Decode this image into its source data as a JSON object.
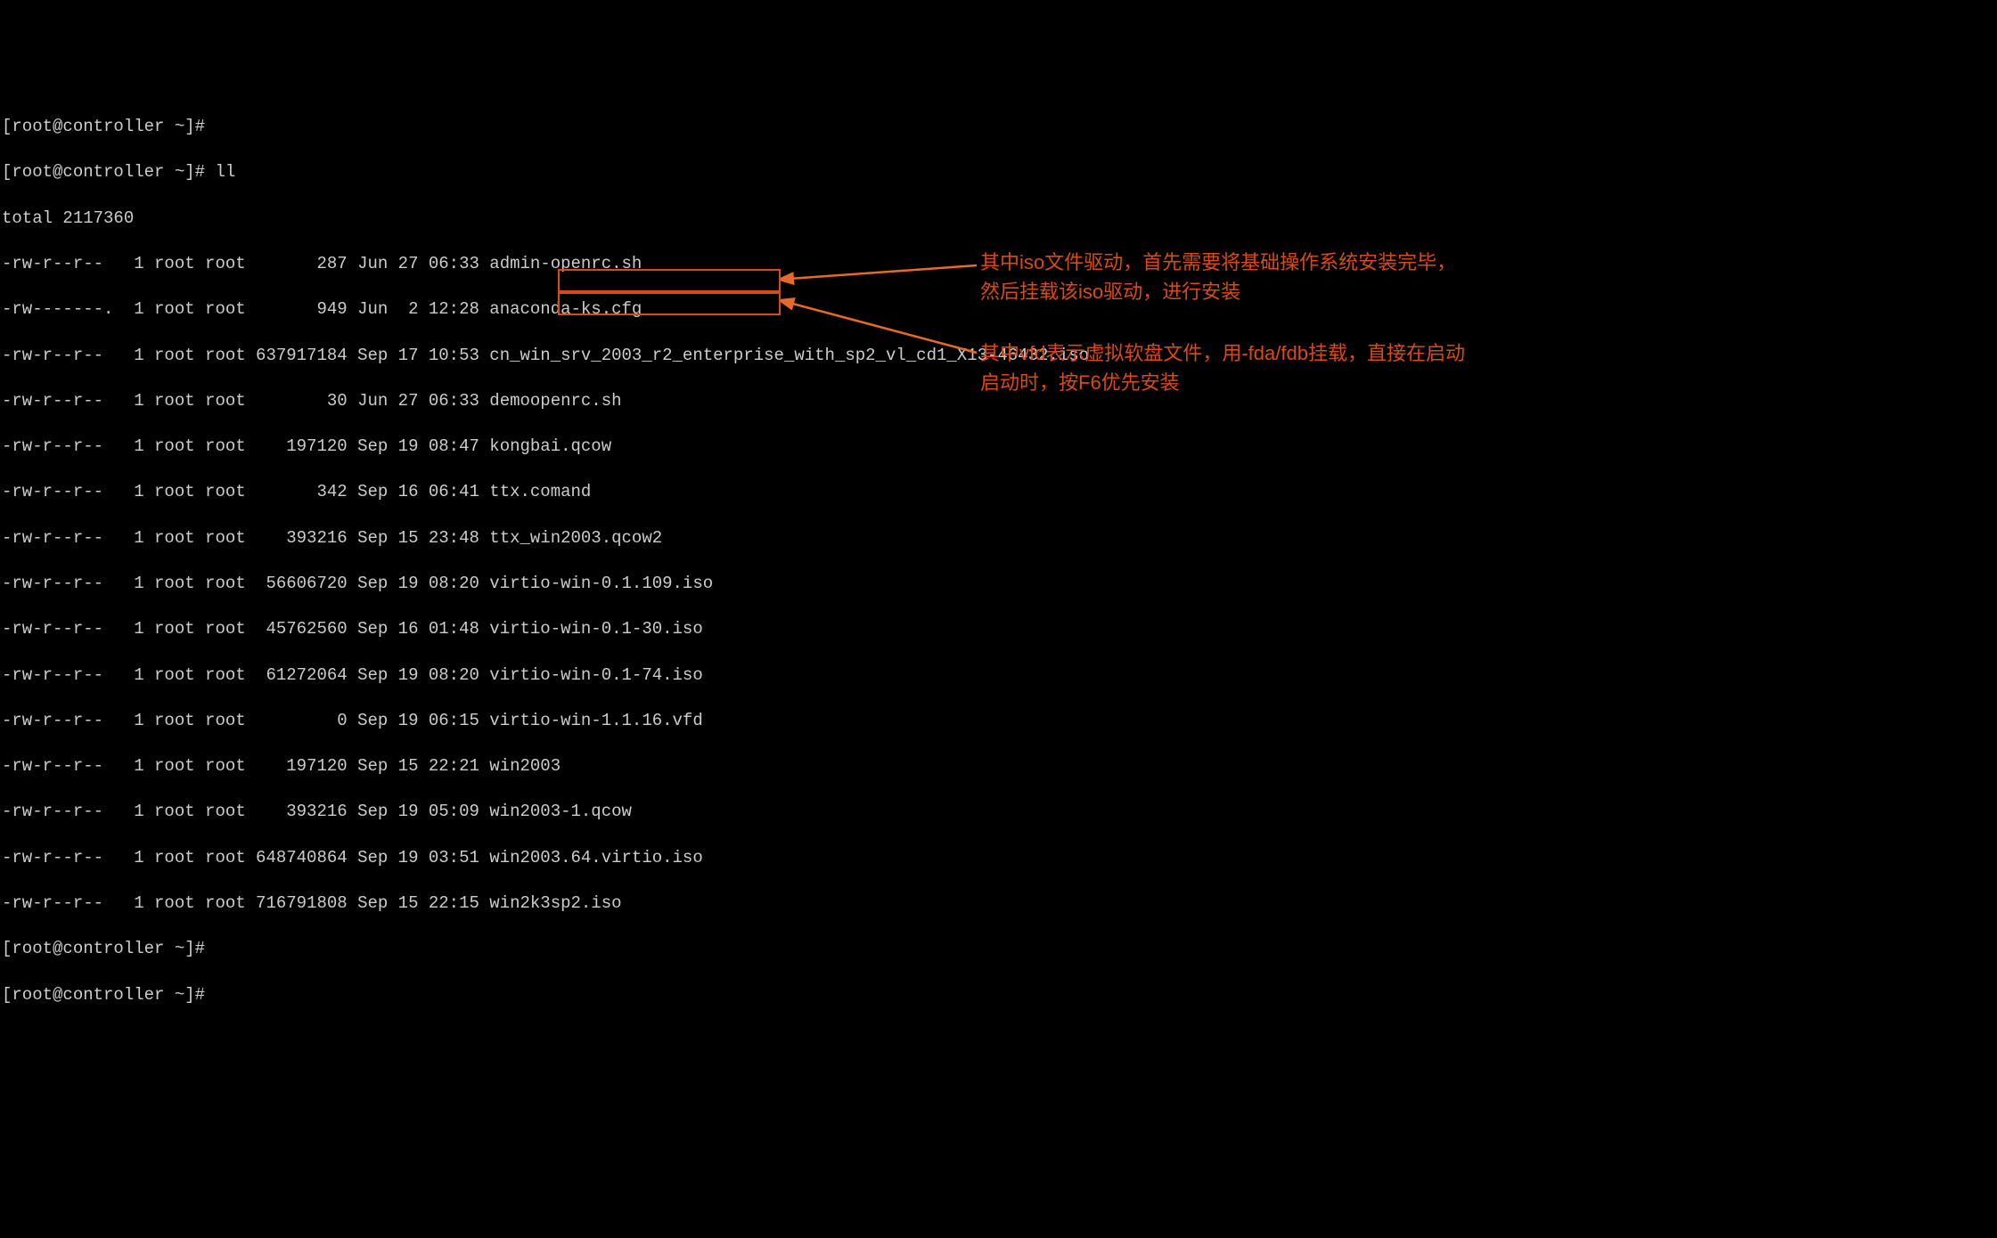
{
  "terminal": {
    "prompts": [
      "[root@controller ~]#",
      "[root@controller ~]# ll",
      "total 2117360"
    ],
    "trailing_prompts": [
      "[root@controller ~]#",
      "[root@controller ~]#"
    ],
    "rows": [
      {
        "perm": "-rw-r--r--",
        "link": "1",
        "owner": "root",
        "group": "root",
        "size": "287",
        "month": "Jun",
        "day": "27",
        "time": "06:33",
        "name": "admin-openrc.sh"
      },
      {
        "perm": "-rw-------.",
        "link": "1",
        "owner": "root",
        "group": "root",
        "size": "949",
        "month": "Jun",
        "day": " 2",
        "time": "12:28",
        "name": "anaconda-ks.cfg"
      },
      {
        "perm": "-rw-r--r--",
        "link": "1",
        "owner": "root",
        "group": "root",
        "size": "637917184",
        "month": "Sep",
        "day": "17",
        "time": "10:53",
        "name": "cn_win_srv_2003_r2_enterprise_with_sp2_vl_cd1_X13-46432.iso"
      },
      {
        "perm": "-rw-r--r--",
        "link": "1",
        "owner": "root",
        "group": "root",
        "size": "30",
        "month": "Jun",
        "day": "27",
        "time": "06:33",
        "name": "demoopenrc.sh"
      },
      {
        "perm": "-rw-r--r--",
        "link": "1",
        "owner": "root",
        "group": "root",
        "size": "197120",
        "month": "Sep",
        "day": "19",
        "time": "08:47",
        "name": "kongbai.qcow"
      },
      {
        "perm": "-rw-r--r--",
        "link": "1",
        "owner": "root",
        "group": "root",
        "size": "342",
        "month": "Sep",
        "day": "16",
        "time": "06:41",
        "name": "ttx.comand"
      },
      {
        "perm": "-rw-r--r--",
        "link": "1",
        "owner": "root",
        "group": "root",
        "size": "393216",
        "month": "Sep",
        "day": "15",
        "time": "23:48",
        "name": "ttx_win2003.qcow2"
      },
      {
        "perm": "-rw-r--r--",
        "link": "1",
        "owner": "root",
        "group": "root",
        "size": "56606720",
        "month": "Sep",
        "day": "19",
        "time": "08:20",
        "name": "virtio-win-0.1.109.iso"
      },
      {
        "perm": "-rw-r--r--",
        "link": "1",
        "owner": "root",
        "group": "root",
        "size": "45762560",
        "month": "Sep",
        "day": "16",
        "time": "01:48",
        "name": "virtio-win-0.1-30.iso"
      },
      {
        "perm": "-rw-r--r--",
        "link": "1",
        "owner": "root",
        "group": "root",
        "size": "61272064",
        "month": "Sep",
        "day": "19",
        "time": "08:20",
        "name": "virtio-win-0.1-74.iso"
      },
      {
        "perm": "-rw-r--r--",
        "link": "1",
        "owner": "root",
        "group": "root",
        "size": "0",
        "month": "Sep",
        "day": "19",
        "time": "06:15",
        "name": "virtio-win-1.1.16.vfd"
      },
      {
        "perm": "-rw-r--r--",
        "link": "1",
        "owner": "root",
        "group": "root",
        "size": "197120",
        "month": "Sep",
        "day": "15",
        "time": "22:21",
        "name": "win2003"
      },
      {
        "perm": "-rw-r--r--",
        "link": "1",
        "owner": "root",
        "group": "root",
        "size": "393216",
        "month": "Sep",
        "day": "19",
        "time": "05:09",
        "name": "win2003-1.qcow"
      },
      {
        "perm": "-rw-r--r--",
        "link": "1",
        "owner": "root",
        "group": "root",
        "size": "648740864",
        "month": "Sep",
        "day": "19",
        "time": "03:51",
        "name": "win2003.64.virtio.iso"
      },
      {
        "perm": "-rw-r--r--",
        "link": "1",
        "owner": "root",
        "group": "root",
        "size": "716791808",
        "month": "Sep",
        "day": "15",
        "time": "22:15",
        "name": "win2k3sp2.iso"
      }
    ]
  },
  "annotations": {
    "iso_note": "其中iso文件驱动，首先需要将基础操作系统安装完毕，然后挂载该iso驱动，进行安装",
    "vfd_note": "其中vfd表示虚拟软盘文件，用-fda/fdb挂载，直接在启动启动时，按F6优先安装"
  }
}
